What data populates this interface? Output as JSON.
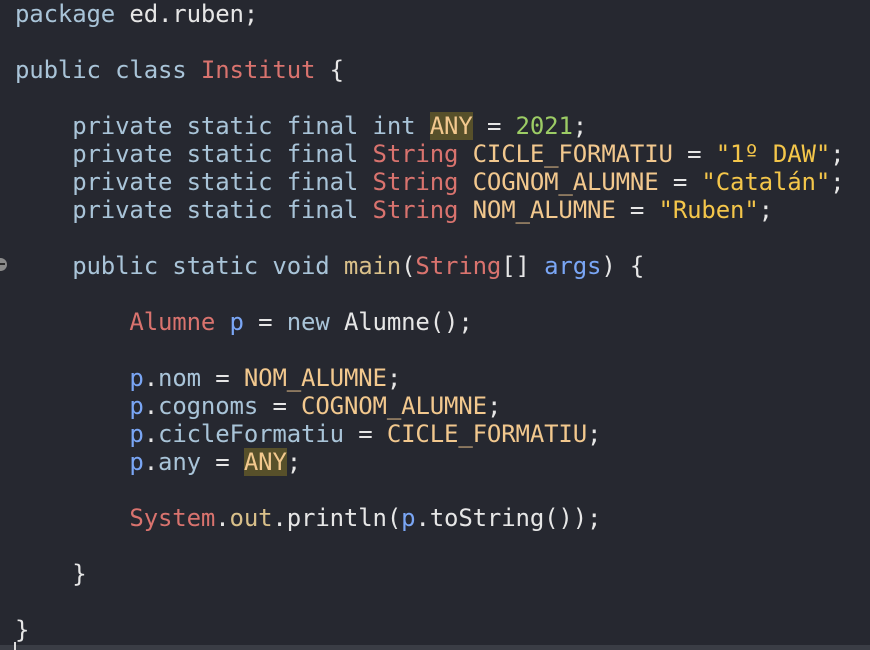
{
  "colors": {
    "background": "#262830",
    "default_text": "#e6e6e6",
    "keyword": "#a9c4d8",
    "type": "#d9736e",
    "constant": "#f2c88e",
    "string": "#f4c64a",
    "number": "#9ccc65",
    "variable": "#7aa6f5",
    "method": "#d9c08a",
    "highlight": "#57502a"
  },
  "gutter": {
    "marker_icon": "fold-collapse-icon"
  },
  "code": [
    {
      "tokens": [
        {
          "t": "package",
          "c": "keyword"
        },
        {
          "t": " ed.ruben;",
          "c": "default_text"
        }
      ]
    },
    {
      "tokens": []
    },
    {
      "tokens": [
        {
          "t": "public",
          "c": "keyword"
        },
        {
          "t": " ",
          "c": "default_text"
        },
        {
          "t": "class",
          "c": "keyword"
        },
        {
          "t": " ",
          "c": "default_text"
        },
        {
          "t": "Institut",
          "c": "type"
        },
        {
          "t": " {",
          "c": "default_text"
        }
      ]
    },
    {
      "tokens": []
    },
    {
      "tokens": [
        {
          "t": "    ",
          "c": "default_text"
        },
        {
          "t": "private static final",
          "c": "keyword"
        },
        {
          "t": " ",
          "c": "default_text"
        },
        {
          "t": "int",
          "c": "keyword"
        },
        {
          "t": " ",
          "c": "default_text"
        },
        {
          "t": "ANY",
          "c": "constant",
          "hl": true
        },
        {
          "t": " = ",
          "c": "default_text"
        },
        {
          "t": "2021",
          "c": "number"
        },
        {
          "t": ";",
          "c": "default_text"
        }
      ]
    },
    {
      "tokens": [
        {
          "t": "    ",
          "c": "default_text"
        },
        {
          "t": "private static final",
          "c": "keyword"
        },
        {
          "t": " ",
          "c": "default_text"
        },
        {
          "t": "String",
          "c": "type"
        },
        {
          "t": " ",
          "c": "default_text"
        },
        {
          "t": "CICLE_FORMATIU",
          "c": "constant"
        },
        {
          "t": " = ",
          "c": "default_text"
        },
        {
          "t": "\"1º DAW\"",
          "c": "string"
        },
        {
          "t": ";",
          "c": "default_text"
        }
      ]
    },
    {
      "tokens": [
        {
          "t": "    ",
          "c": "default_text"
        },
        {
          "t": "private static final",
          "c": "keyword"
        },
        {
          "t": " ",
          "c": "default_text"
        },
        {
          "t": "String",
          "c": "type"
        },
        {
          "t": " ",
          "c": "default_text"
        },
        {
          "t": "COGNOM_ALUMNE",
          "c": "constant"
        },
        {
          "t": " = ",
          "c": "default_text"
        },
        {
          "t": "\"Catalán\"",
          "c": "string"
        },
        {
          "t": ";",
          "c": "default_text"
        }
      ]
    },
    {
      "tokens": [
        {
          "t": "    ",
          "c": "default_text"
        },
        {
          "t": "private static final",
          "c": "keyword"
        },
        {
          "t": " ",
          "c": "default_text"
        },
        {
          "t": "String",
          "c": "type"
        },
        {
          "t": " ",
          "c": "default_text"
        },
        {
          "t": "NOM_ALUMNE",
          "c": "constant"
        },
        {
          "t": " = ",
          "c": "default_text"
        },
        {
          "t": "\"Ruben\"",
          "c": "string"
        },
        {
          "t": ";",
          "c": "default_text"
        }
      ]
    },
    {
      "tokens": []
    },
    {
      "tokens": [
        {
          "t": "    ",
          "c": "default_text"
        },
        {
          "t": "public static void",
          "c": "keyword"
        },
        {
          "t": " ",
          "c": "default_text"
        },
        {
          "t": "main",
          "c": "method"
        },
        {
          "t": "(",
          "c": "default_text"
        },
        {
          "t": "String",
          "c": "type"
        },
        {
          "t": "[] ",
          "c": "default_text"
        },
        {
          "t": "args",
          "c": "variable"
        },
        {
          "t": ") {",
          "c": "default_text"
        }
      ]
    },
    {
      "tokens": []
    },
    {
      "tokens": [
        {
          "t": "        ",
          "c": "default_text"
        },
        {
          "t": "Alumne",
          "c": "type"
        },
        {
          "t": " ",
          "c": "default_text"
        },
        {
          "t": "p",
          "c": "variable"
        },
        {
          "t": " = ",
          "c": "default_text"
        },
        {
          "t": "new",
          "c": "keyword"
        },
        {
          "t": " Alumne();",
          "c": "default_text"
        }
      ]
    },
    {
      "tokens": []
    },
    {
      "tokens": [
        {
          "t": "        ",
          "c": "default_text"
        },
        {
          "t": "p",
          "c": "variable"
        },
        {
          "t": ".",
          "c": "default_text"
        },
        {
          "t": "nom",
          "c": "keyword"
        },
        {
          "t": " = ",
          "c": "default_text"
        },
        {
          "t": "NOM_ALUMNE",
          "c": "constant"
        },
        {
          "t": ";",
          "c": "default_text"
        }
      ]
    },
    {
      "tokens": [
        {
          "t": "        ",
          "c": "default_text"
        },
        {
          "t": "p",
          "c": "variable"
        },
        {
          "t": ".",
          "c": "default_text"
        },
        {
          "t": "cognoms",
          "c": "keyword"
        },
        {
          "t": " = ",
          "c": "default_text"
        },
        {
          "t": "COGNOM_ALUMNE",
          "c": "constant"
        },
        {
          "t": ";",
          "c": "default_text"
        }
      ]
    },
    {
      "tokens": [
        {
          "t": "        ",
          "c": "default_text"
        },
        {
          "t": "p",
          "c": "variable"
        },
        {
          "t": ".",
          "c": "default_text"
        },
        {
          "t": "cicleFormatiu",
          "c": "keyword"
        },
        {
          "t": " = ",
          "c": "default_text"
        },
        {
          "t": "CICLE_FORMATIU",
          "c": "constant"
        },
        {
          "t": ";",
          "c": "default_text"
        }
      ]
    },
    {
      "tokens": [
        {
          "t": "        ",
          "c": "default_text"
        },
        {
          "t": "p",
          "c": "variable"
        },
        {
          "t": ".",
          "c": "default_text"
        },
        {
          "t": "any",
          "c": "keyword"
        },
        {
          "t": " = ",
          "c": "default_text"
        },
        {
          "t": "ANY",
          "c": "constant",
          "hl": true
        },
        {
          "t": ";",
          "c": "default_text"
        }
      ]
    },
    {
      "tokens": []
    },
    {
      "tokens": [
        {
          "t": "        ",
          "c": "default_text"
        },
        {
          "t": "System",
          "c": "type"
        },
        {
          "t": ".",
          "c": "default_text"
        },
        {
          "t": "out",
          "c": "method"
        },
        {
          "t": ".println(",
          "c": "default_text"
        },
        {
          "t": "p",
          "c": "variable"
        },
        {
          "t": ".toString());",
          "c": "default_text"
        }
      ]
    },
    {
      "tokens": []
    },
    {
      "tokens": [
        {
          "t": "    }",
          "c": "default_text"
        }
      ]
    },
    {
      "tokens": []
    },
    {
      "tokens": [
        {
          "t": "}",
          "c": "default_text"
        }
      ]
    }
  ]
}
